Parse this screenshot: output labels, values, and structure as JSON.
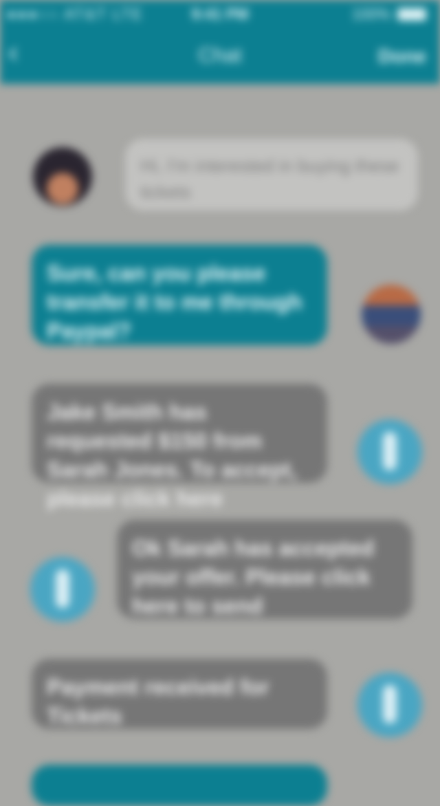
{
  "status_bar": {
    "carrier": "●●●○○ AT&T  LTE",
    "time": "9:41 PM",
    "battery": "100%"
  },
  "nav": {
    "title": "Chat",
    "action": "Done"
  },
  "messages": [
    {
      "text": "Hi, I'm interested in buying these tickets"
    },
    {
      "text": "Sure, can you please transfer it to me through Paypal?"
    },
    {
      "text": "Jake Smith has requested $150 from Sarah Jones. To accept, please click here"
    },
    {
      "text": "Ok Sarah has accepted your offer. Please click here to send"
    },
    {
      "text": "Payment received for Tickets"
    }
  ]
}
